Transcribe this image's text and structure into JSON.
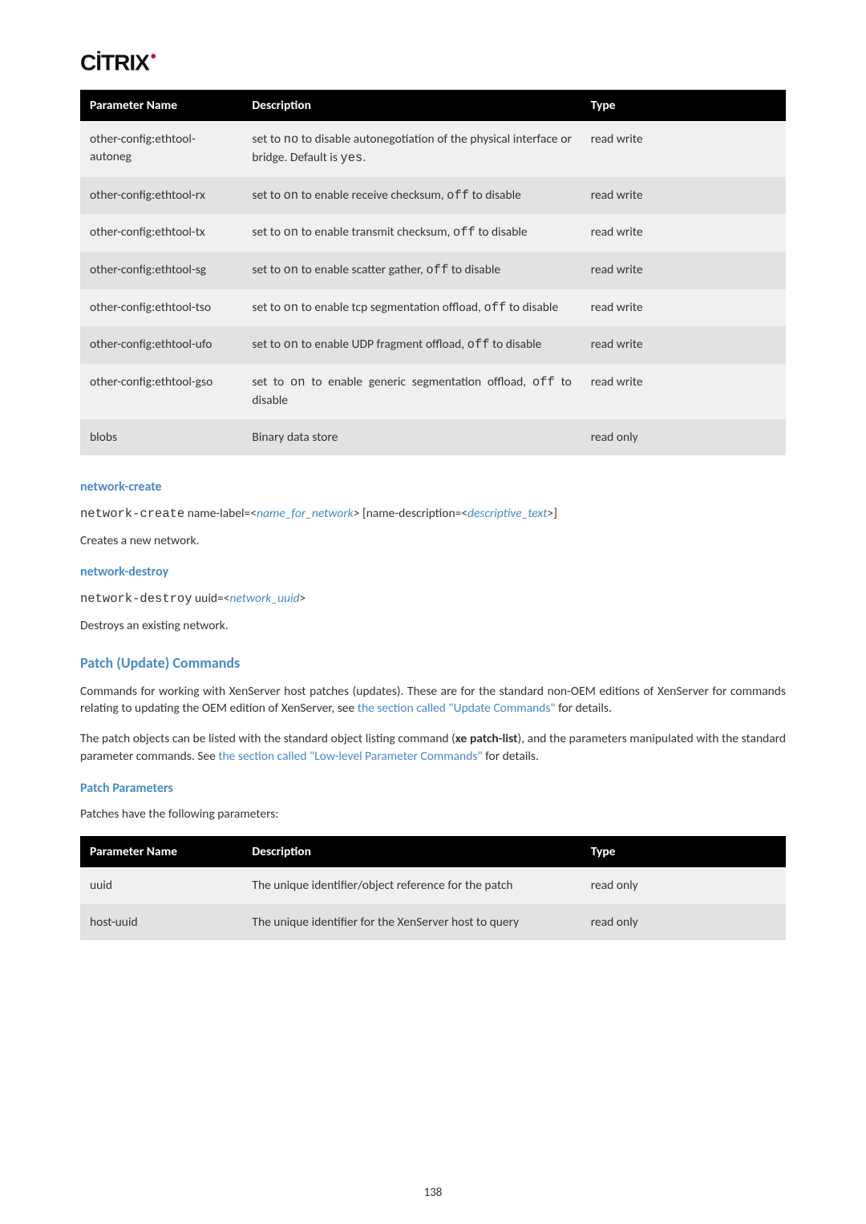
{
  "logo": {
    "text": "CİTRIX",
    "dot": "•"
  },
  "table1": {
    "headers": [
      "Parameter Name",
      "Description",
      "Type"
    ],
    "rows": [
      {
        "name": "other-config:ethtool-autoneg",
        "desc": [
          "set to ",
          "no",
          " to disable autonegotiation of the physical interface or bridge. Default is ",
          "yes",
          "."
        ],
        "type": "read write"
      },
      {
        "name": "other-config:ethtool-rx",
        "desc": [
          "set to ",
          "on",
          " to enable receive checksum, ",
          "off",
          " to disable"
        ],
        "type": "read write"
      },
      {
        "name": "other-config:ethtool-tx",
        "desc": [
          "set to ",
          "on",
          " to enable transmit checksum, ",
          "off",
          " to disable"
        ],
        "type": "read write"
      },
      {
        "name": "other-config:ethtool-sg",
        "desc": [
          "set to ",
          "on",
          " to enable scatter gather, ",
          "off",
          " to disable"
        ],
        "type": "read write"
      },
      {
        "name": "other-config:ethtool-tso",
        "desc": [
          "set to ",
          "on",
          " to enable tcp segmentation offload, ",
          "off",
          " to disable"
        ],
        "type": "read write"
      },
      {
        "name": "other-config:ethtool-ufo",
        "desc": [
          "set to ",
          "on",
          " to enable UDP fragment offload, ",
          "off",
          " to disable"
        ],
        "type": "read write"
      },
      {
        "name": "other-config:ethtool-gso",
        "desc": [
          "set to ",
          "on",
          " to enable generic segmentation offload, ",
          "off",
          " to disable"
        ],
        "type": "read write"
      },
      {
        "name": "blobs",
        "desc": [
          "Binary data store"
        ],
        "type": "read only"
      }
    ]
  },
  "network_create": {
    "heading": "network-create",
    "code_cmd": "network-create",
    "code_rest": " name-label=",
    "arg1_open": "<",
    "arg1": "name_for_network",
    "arg1_close": ">",
    "mid": " [name-description=",
    "arg2_open": "<",
    "arg2": "descriptive_text",
    "arg2_close": ">",
    "end": "]",
    "para": "Creates a new network."
  },
  "network_destroy": {
    "heading": "network-destroy",
    "code_cmd": "network-destroy",
    "code_rest": " uuid=",
    "arg1_open": "<",
    "arg1": "network_uuid",
    "arg1_close": ">",
    "para": "Destroys an existing network."
  },
  "patch_commands": {
    "heading": "Patch (Update) Commands",
    "para1_pre": "Commands for working with XenServer host patches (updates). These are for the standard non-OEM editions of XenServer for commands relating to updating the OEM edition of XenServer, see ",
    "para1_link": "the section called \"Update Commands\"",
    "para1_post": " for details.",
    "para2_pre": "The patch objects can be listed with the standard object listing command (",
    "para2_bold": "xe patch-list",
    "para2_mid": "), and the parameters manipulated with the standard parameter commands. See ",
    "para2_link": "the section called \"Low-level Parameter Commands\"",
    "para2_post": " for details."
  },
  "patch_params": {
    "heading": "Patch Parameters",
    "intro": "Patches have the following parameters:"
  },
  "table2": {
    "headers": [
      "Parameter Name",
      "Description",
      "Type"
    ],
    "rows": [
      {
        "name": "uuid",
        "desc": "The unique identifier/object reference for the patch",
        "type": "read only"
      },
      {
        "name": "host-uuid",
        "desc": "The unique identifier for the XenServer host to query",
        "type": "read only"
      }
    ]
  },
  "page_number": "138"
}
